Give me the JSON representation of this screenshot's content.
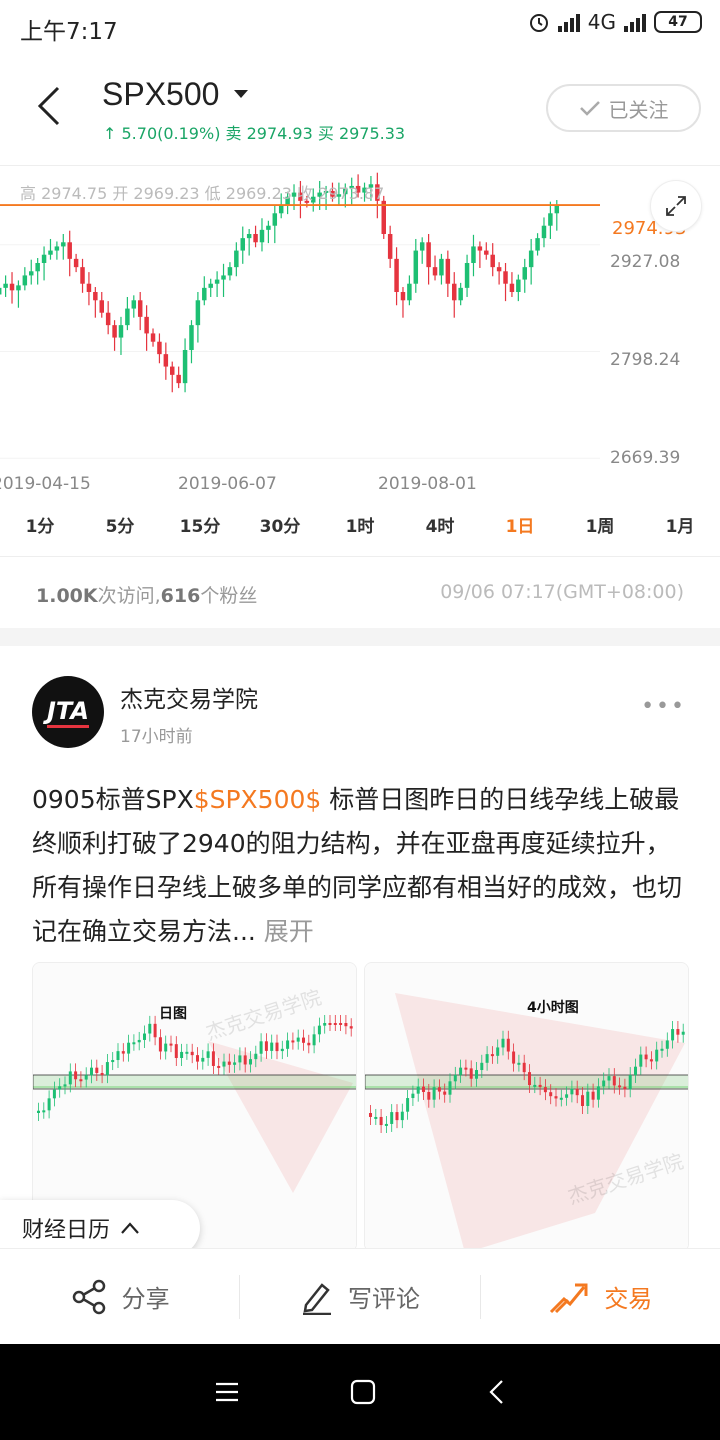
{
  "status_bar": {
    "time": "上午7:17",
    "network": "4G",
    "battery": "47"
  },
  "header": {
    "symbol": "SPX500",
    "quote": "↑ 5.70(0.19%) 卖 2974.93 买 2975.33",
    "follow_label": "已关注"
  },
  "chart": {
    "ohlc": "高 2974.75  开 2969.23  低 2969.23  收 2973.87",
    "current_price": "2974.93",
    "y_labels": [
      "2927.08",
      "2798.24",
      "2669.39"
    ],
    "x_labels": [
      "2019-04-15",
      "2019-06-07",
      "2019-08-01"
    ]
  },
  "chart_data": {
    "type": "candlestick",
    "title": "",
    "x_ticks": [
      "2019-04-15",
      "2019-06-07",
      "2019-08-01"
    ],
    "y_ticks": [
      2927.08,
      2798.24,
      2669.39
    ],
    "ylim": [
      2660,
      3010
    ],
    "last_price": 2974.93,
    "colors": {
      "up": "#1dbf73",
      "down": "#e5343f",
      "price_line": "#f47920"
    }
  },
  "periods": {
    "items": [
      "1分",
      "5分",
      "15分",
      "30分",
      "1时",
      "4时",
      "1日",
      "1周",
      "1月"
    ],
    "active": "1日"
  },
  "stats": {
    "visits_count": "1.00K",
    "visits_suffix": "次访问,",
    "fans_count": "616",
    "fans_suffix": "个粉丝",
    "timestamp": "09/06 07:17(GMT+08:00)"
  },
  "post": {
    "avatar_text": "JTA",
    "author": "杰克交易学院",
    "time_ago": "17小时前",
    "text_before": "0905标普SPX",
    "tag": "$SPX500$",
    "text_after": " 标普日图昨日的日线孕线上破最终顺利打破了2940的阻力结构，并在亚盘再度延续拉升，所有操作日孕线上破多单的同学应都有相当好的成效，也切记在确立交易方法... ",
    "expand_label": "展开",
    "thumb1_title": "日图",
    "thumb2_title": "4小时图",
    "watermark": "杰克交易学院"
  },
  "calendar_pill": {
    "label": "财经日历"
  },
  "actions": {
    "share": "分享",
    "comment": "写评论",
    "trade": "交易"
  },
  "icons": [
    "back-icon",
    "caret-down-icon",
    "check-icon",
    "expand-icon",
    "more-icon",
    "chevron-up-icon",
    "share-icon",
    "pen-icon",
    "trade-icon",
    "menu-icon",
    "home-icon",
    "back-nav-icon"
  ]
}
